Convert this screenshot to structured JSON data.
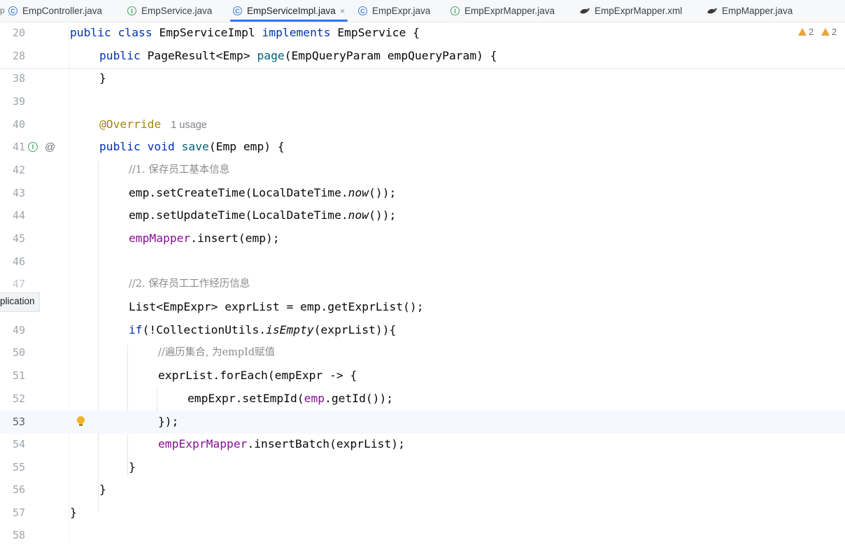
{
  "tabs": [
    {
      "label": "EmpController.java",
      "icon": "class-icon"
    },
    {
      "label": "EmpService.java",
      "icon": "interface-icon"
    },
    {
      "label": "EmpServiceImpl.java",
      "icon": "class-icon",
      "active": true
    },
    {
      "label": "EmpExpr.java",
      "icon": "class-icon"
    },
    {
      "label": "EmpExprMapper.java",
      "icon": "interface-icon"
    },
    {
      "label": "EmpExprMapper.xml",
      "icon": "mybatis-icon"
    },
    {
      "label": "EmpMapper.java",
      "icon": "mybatis-icon"
    }
  ],
  "tab_close": "×",
  "edge_fragment": "p",
  "inspections": {
    "warnings_a": "2",
    "warnings_b": "2"
  },
  "tooltip_fragment": "plication",
  "lines": {
    "l20": "20",
    "l28": "28",
    "l38": "38",
    "l39": "39",
    "l40": "40",
    "l41": "41",
    "l42": "42",
    "l43": "43",
    "l44": "44",
    "l45": "45",
    "l46": "46",
    "l47": "47",
    "l49": "49",
    "l50": "50",
    "l51": "51",
    "l52": "52",
    "l53": "53",
    "l54": "54",
    "l55": "55",
    "l56": "56",
    "l57": "57",
    "l58": "58"
  },
  "code": {
    "c20_kw": "public class",
    "c20_name": " EmpServiceImpl ",
    "c20_kw2": "implements",
    "c20_rest": " EmpService {",
    "c28_kw": "public",
    "c28_type": " PageResult<Emp> ",
    "c28_fn": "page",
    "c28_rest": "(EmpQueryParam empQueryParam) {",
    "c38": "}",
    "c40_ann": "@Override",
    "c40_hint": "1 usage",
    "c41_kw": "public void",
    "c41_fn": " save",
    "c41_rest": "(Emp emp) {",
    "c42": "//1. 保存员工基本信息",
    "c43_a": "emp.setCreateTime(LocalDateTime.",
    "c43_it": "now",
    "c43_b": "());",
    "c44_a": "emp.setUpdateTime(LocalDateTime.",
    "c44_it": "now",
    "c44_b": "());",
    "c45_fld": "empMapper",
    "c45_rest": ".insert(emp);",
    "c47": "//2. 保存员工工作经历信息",
    "c48": "List<EmpExpr> exprList = emp.getExprList();",
    "c49_kw": "if",
    "c49_a": "(!CollectionUtils.",
    "c49_it": "isEmpty",
    "c49_b": "(exprList)){",
    "c50": "//遍历集合, 为empId赋值",
    "c51": "exprList.forEach(empExpr -> {",
    "c52_a": "empExpr.setEmpId(",
    "c52_fld": "emp",
    "c52_b": ".getId());",
    "c53": "});",
    "c54_fld": "empExprMapper",
    "c54_rest": ".insertBatch(exprList);",
    "c55": "}",
    "c56": "}",
    "c57": "}"
  }
}
